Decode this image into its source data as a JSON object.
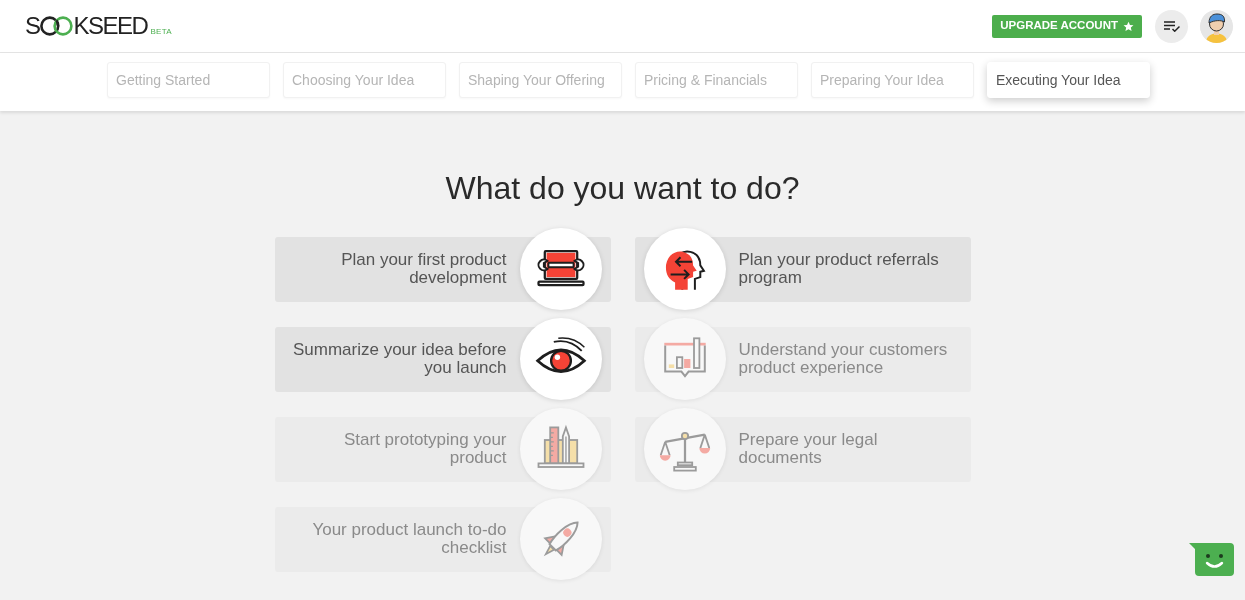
{
  "header": {
    "logo": {
      "text_start": "S",
      "text_end": "KSEED",
      "tag": "BETA"
    },
    "upgrade_button": {
      "label": "UPGRADE ACCOUNT"
    }
  },
  "tabs": [
    {
      "label": "Getting Started",
      "selected": false
    },
    {
      "label": "Choosing Your Idea",
      "selected": false
    },
    {
      "label": "Shaping Your Offering",
      "selected": false
    },
    {
      "label": "Pricing & Financials",
      "selected": false
    },
    {
      "label": "Preparing Your Idea",
      "selected": false
    },
    {
      "label": "Executing Your Idea",
      "selected": true
    }
  ],
  "heading": "What do you want to do?",
  "options": [
    {
      "label": "Plan your first product development",
      "kind": "development",
      "disabled": false
    },
    {
      "label": "Plan your product referrals program",
      "kind": "referrals",
      "disabled": false
    },
    {
      "label": "Summarize your idea before you launch",
      "kind": "summary",
      "disabled": false
    },
    {
      "label": "Understand your customers product experience",
      "kind": "feedback",
      "disabled": true
    },
    {
      "label": "Start prototyping your product",
      "kind": "prototype",
      "disabled": true
    },
    {
      "label": "Prepare your legal documents",
      "kind": "legal",
      "disabled": true
    },
    {
      "label": "Your product launch to-do checklist",
      "kind": "launch",
      "disabled": true
    }
  ]
}
